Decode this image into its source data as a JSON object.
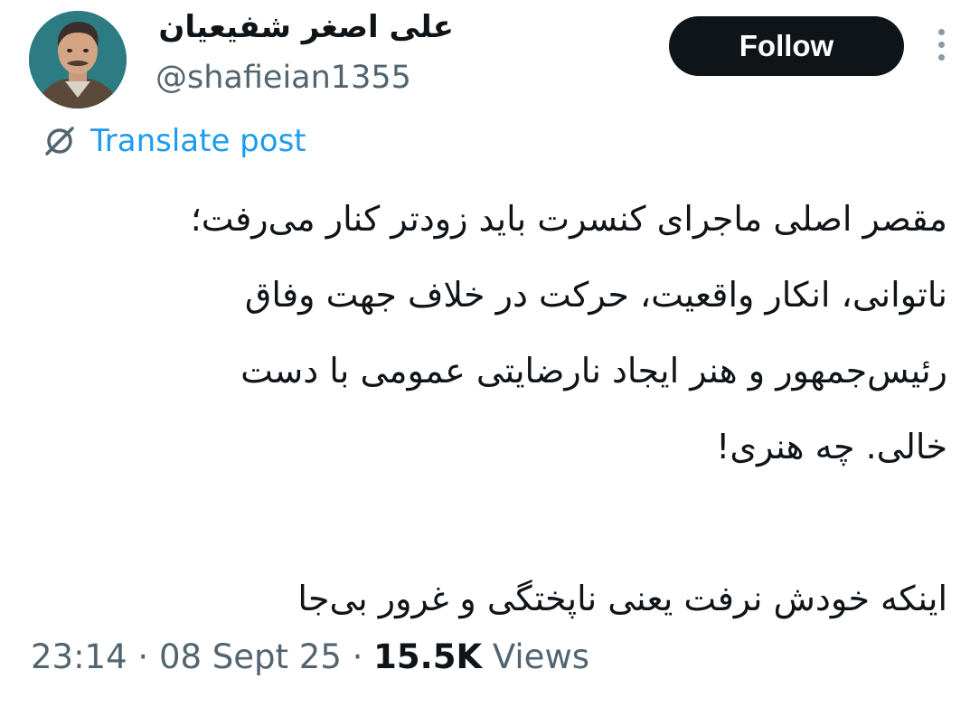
{
  "author": {
    "display_name": "علی اصغر شفیعیان",
    "handle": "@shafieian1355"
  },
  "actions": {
    "follow_label": "Follow"
  },
  "translate": {
    "label": "Translate post",
    "icon": "translate-globe-icon"
  },
  "tweet": {
    "lines": [
      "مقصر اصلی ماجرای کنسرت باید زودتر کنار می‌رفت؛",
      "ناتوانی، انکار واقعیت، حرکت در خلاف جهت وفاق",
      "رئیس‌جمهور و هنر ایجاد نارضایتی عمومی با دست",
      "خالی. چه هنری!",
      "",
      "اینکه خودش نرفت یعنی ناپختگی و غرور بی‌جا"
    ]
  },
  "meta": {
    "time": "23:14",
    "separator_1": " · ",
    "date": "08 Sept 25",
    "separator_2": " · ",
    "views_count": "15.5K",
    "views_label": " Views"
  },
  "colors": {
    "text_primary": "#0f1419",
    "text_secondary": "#536471",
    "link_blue": "#1d9bf0",
    "follow_bg": "#0f1419",
    "follow_text": "#ffffff"
  }
}
